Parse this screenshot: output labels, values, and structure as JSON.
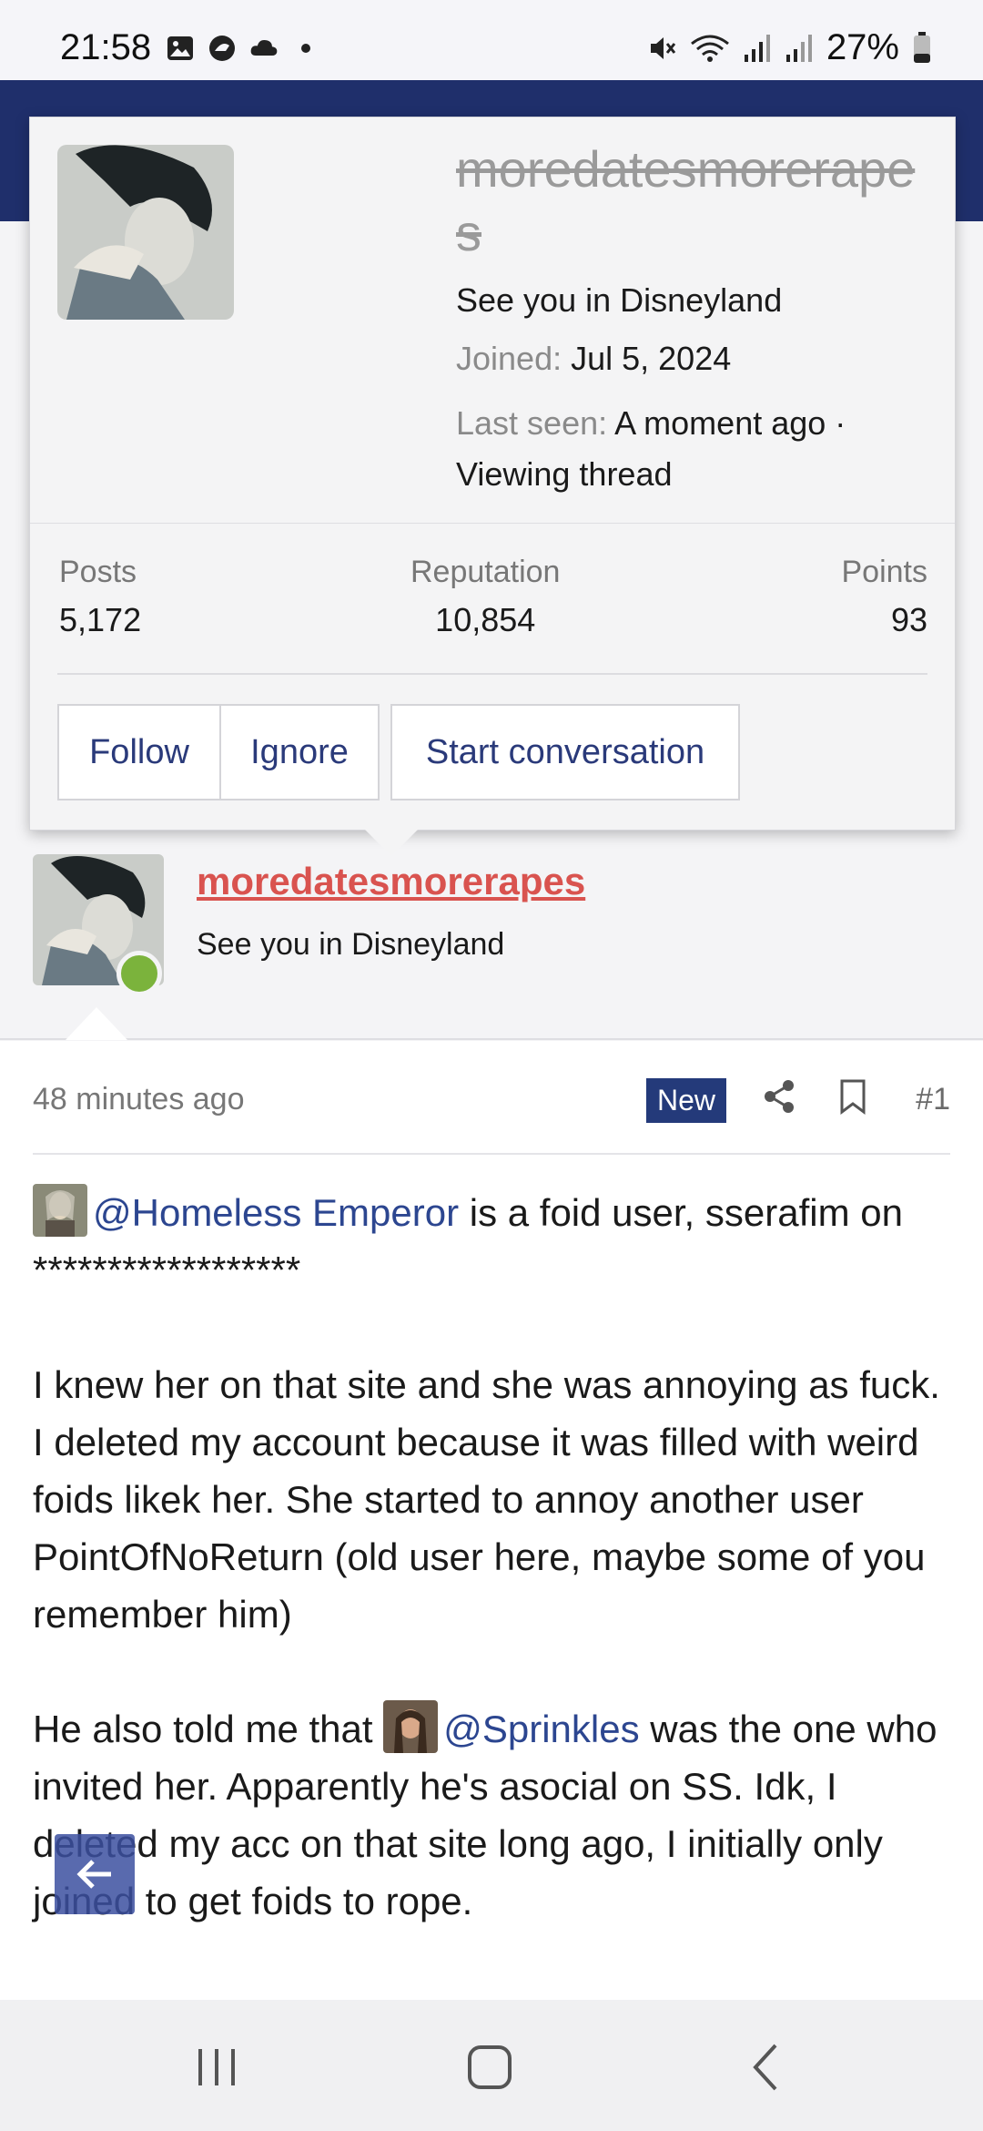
{
  "status_bar": {
    "time": "21:58",
    "battery": "27%",
    "icons": [
      "gallery-icon",
      "messenger-icon",
      "cloud-icon",
      "dot-icon",
      "mute-icon",
      "wifi-icon",
      "signal-icon",
      "signal-icon",
      "battery-icon"
    ]
  },
  "member_card": {
    "username": "moredatesmorerapes",
    "custom_title": "See you in Disneyland",
    "joined_label": "Joined:",
    "joined_value": "Jul 5, 2024",
    "last_seen_label": "Last seen:",
    "last_seen_value": "A moment ago · Viewing thread",
    "stats": {
      "posts_label": "Posts",
      "posts_value": "5,172",
      "reputation_label": "Reputation",
      "reputation_value": "10,854",
      "points_label": "Points",
      "points_value": "93"
    },
    "buttons": {
      "follow": "Follow",
      "ignore": "Ignore",
      "start_conversation": "Start conversation"
    }
  },
  "post": {
    "author_name": "moredatesmorerapes",
    "author_title": "See you in Disneyland",
    "time": "48 minutes ago",
    "badge": "New",
    "number": "#1",
    "p1_mention": "@Homeless Emperor",
    "p1_text": " is a foid user, sserafim on ******************",
    "p2": "I knew her on that site and she was annoying as fuck. I deleted my account because it was filled with weird foids likek her. She started to annoy another user PointOfNoReturn (old user here, maybe some of you remember him)",
    "p3_before": "He also told me that ",
    "p3_mention": "@Sprinkles",
    "p3_after": " was the one who invited her. Apparently he's asocial on SS. Idk, I deleted my acc on that site long ago, I initially only joined to get foids to rope."
  },
  "colors": {
    "header": "#1f2f6b",
    "accent": "#2c4690",
    "username": "#d9534f",
    "online": "#7bb33c",
    "badge_new": "#243a7a"
  }
}
